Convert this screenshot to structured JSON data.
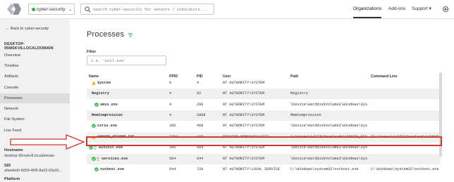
{
  "topbar": {
    "org_select": "cyber-security",
    "search_placeholder": "Search cyber-security for sensors / indicators...",
    "nav": {
      "organizations": "Organizations",
      "addons": "Add-ons",
      "support": "Support ▾"
    }
  },
  "sidebar": {
    "back": "← Back to cyber-security",
    "hostname_header": "DESKTOP-95MSKV8.LOCALDOMAIN",
    "items": [
      "Overview",
      "Timeline",
      "Artifacts",
      "Console",
      "Processes",
      "Network",
      "File System",
      "Live Feed"
    ],
    "active_item": "Processes",
    "meta": {
      "hostname_label": "Hostname",
      "hostname_value": "desktop-95mskv8.localdomain",
      "sid_label": "SID",
      "sid_value": "afaedeb5-8d09-46f6-8a02-93a91...",
      "platform_label": "Platform"
    }
  },
  "main": {
    "title": "Processes",
    "filter_label": "Filter",
    "filter_placeholder": "i.e. 'evil.exe'",
    "columns": {
      "name": "Name",
      "ppid": "PPID",
      "pid": "PID",
      "user": "User",
      "path": "Path",
      "cmd": "Command Line"
    },
    "rows": [
      {
        "name": "System",
        "ppid": "0",
        "pid": "4",
        "user": "NT AUTHORITY\\SYSTEM",
        "path": "",
        "cmd": "",
        "icon": "warning-icon",
        "indent": 1
      },
      {
        "name": "Registry",
        "ppid": "4",
        "pid": "92",
        "user": "NT AUTHORITY\\SYSTEM",
        "path": "Registry",
        "cmd": "",
        "icon": "",
        "indent": 1
      },
      {
        "name": "smss.exe",
        "ppid": "4",
        "pid": "296",
        "user": "NT AUTHORITY\\SYSTEM",
        "path": "\\Device\\HarddiskVolume3\\Windows\\Sys...",
        "cmd": "",
        "icon": "check-icon",
        "indent": 2
      },
      {
        "name": "MemCompression",
        "ppid": "4",
        "pid": "2808",
        "user": "NT AUTHORITY\\SYSTEM",
        "path": "MemCompression",
        "cmd": "",
        "icon": "",
        "indent": 1
      },
      {
        "name": "csrss.exe",
        "ppid": "396",
        "pid": "408",
        "user": "NT AUTHORITY\\SYSTEM",
        "path": "\\Device\\HarddiskVolume3\\Windows\\Sys...",
        "cmd": "",
        "icon": "check-icon",
        "indent": 1
      },
      {
        "name": "HUNGRY_BEYOND.EXE",
        "ppid": "7784",
        "pid": "428",
        "user": "DESKTOP-95MSKV8\\14377",
        "path": "C:\\Users\\14377\\Downloads\\HUNGRY_BEY...",
        "cmd": "\"C:\\Users\\14377\\Downloads\\HUNGRY_B",
        "icon": "warning-icon",
        "indent": 1
      },
      {
        "name": "wininit.exe",
        "ppid": "396",
        "pid": "504",
        "user": "NT AUTHORITY\\SYSTEM",
        "path": "\\Device\\HarddiskVolume3\\Windows\\Sys...",
        "cmd": "",
        "icon": "check-wifi-icon",
        "indent": 0
      },
      {
        "name": "services.exe",
        "ppid": "504",
        "pid": "644",
        "user": "NT AUTHORITY\\SYSTEM",
        "path": "\\Device\\HarddiskVolume3\\Windows\\Sys...",
        "cmd": "",
        "icon": "check-wifi-icon",
        "indent": 1
      },
      {
        "name": "svchost.exe",
        "ppid": "644",
        "pid": "720",
        "user": "NT AUTHORITY\\LOCAL SERVICE",
        "path": "C:\\Windows\\system32\\svchost.exe",
        "cmd": "C:\\Windows\\system32\\svchost.exe -k",
        "icon": "check-icon",
        "indent": 2
      }
    ]
  },
  "colors": {
    "highlight": "#d4352f",
    "ok": "#2fb344",
    "warn": "#e6b422",
    "alt_row": "#f0f0f0",
    "sidebar_bg": "#f1f1f1"
  }
}
